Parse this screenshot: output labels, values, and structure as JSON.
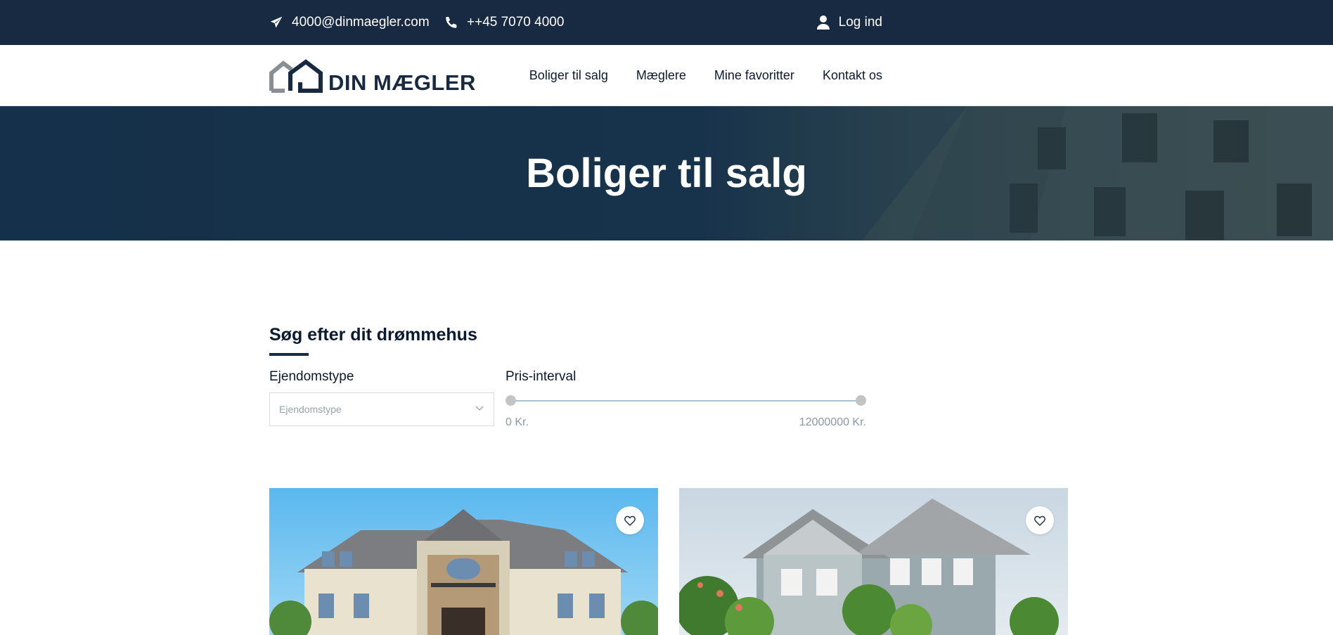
{
  "topbar": {
    "email": "4000@dinmaegler.com",
    "phone": "++45 7070 4000",
    "login": "Log ind",
    "icons": [
      "paper-plane-icon",
      "phone-icon",
      "user-icon"
    ]
  },
  "brand": {
    "name": "DIN MÆGLER"
  },
  "nav": {
    "items": [
      {
        "label": "Boliger til salg"
      },
      {
        "label": "Mæglere"
      },
      {
        "label": "Mine favoritter"
      },
      {
        "label": "Kontakt os"
      }
    ]
  },
  "hero": {
    "title": "Boliger til salg"
  },
  "search": {
    "title": "Søg efter dit drømmehus",
    "type_label": "Ejendomstype",
    "type_placeholder": "Ejendomstype",
    "price_label": "Pris-interval",
    "price_min": "0 Kr.",
    "price_max": "12000000 Kr."
  },
  "colors": {
    "primary": "#172a41",
    "accent_track": "#aac4d6",
    "muted_text": "#8e97a1"
  },
  "cards": [
    {
      "favorite_icon": "heart-icon"
    },
    {
      "favorite_icon": "heart-icon"
    }
  ]
}
